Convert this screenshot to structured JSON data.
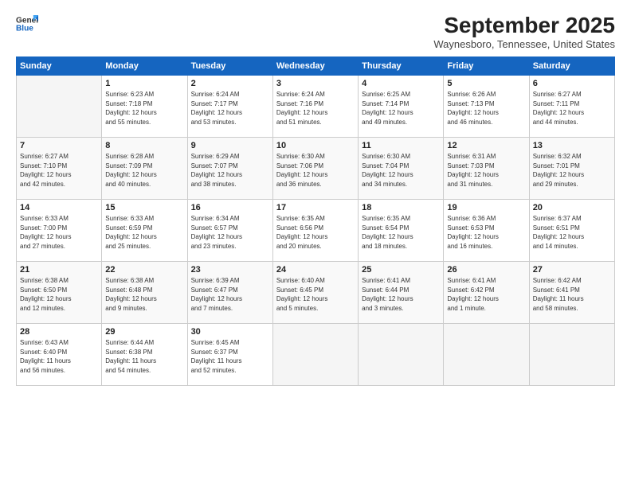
{
  "header": {
    "logo_line1": "General",
    "logo_line2": "Blue",
    "month_title": "September 2025",
    "location": "Waynesboro, Tennessee, United States"
  },
  "weekdays": [
    "Sunday",
    "Monday",
    "Tuesday",
    "Wednesday",
    "Thursday",
    "Friday",
    "Saturday"
  ],
  "weeks": [
    [
      {
        "day": "",
        "info": ""
      },
      {
        "day": "1",
        "info": "Sunrise: 6:23 AM\nSunset: 7:18 PM\nDaylight: 12 hours\nand 55 minutes."
      },
      {
        "day": "2",
        "info": "Sunrise: 6:24 AM\nSunset: 7:17 PM\nDaylight: 12 hours\nand 53 minutes."
      },
      {
        "day": "3",
        "info": "Sunrise: 6:24 AM\nSunset: 7:16 PM\nDaylight: 12 hours\nand 51 minutes."
      },
      {
        "day": "4",
        "info": "Sunrise: 6:25 AM\nSunset: 7:14 PM\nDaylight: 12 hours\nand 49 minutes."
      },
      {
        "day": "5",
        "info": "Sunrise: 6:26 AM\nSunset: 7:13 PM\nDaylight: 12 hours\nand 46 minutes."
      },
      {
        "day": "6",
        "info": "Sunrise: 6:27 AM\nSunset: 7:11 PM\nDaylight: 12 hours\nand 44 minutes."
      }
    ],
    [
      {
        "day": "7",
        "info": "Sunrise: 6:27 AM\nSunset: 7:10 PM\nDaylight: 12 hours\nand 42 minutes."
      },
      {
        "day": "8",
        "info": "Sunrise: 6:28 AM\nSunset: 7:09 PM\nDaylight: 12 hours\nand 40 minutes."
      },
      {
        "day": "9",
        "info": "Sunrise: 6:29 AM\nSunset: 7:07 PM\nDaylight: 12 hours\nand 38 minutes."
      },
      {
        "day": "10",
        "info": "Sunrise: 6:30 AM\nSunset: 7:06 PM\nDaylight: 12 hours\nand 36 minutes."
      },
      {
        "day": "11",
        "info": "Sunrise: 6:30 AM\nSunset: 7:04 PM\nDaylight: 12 hours\nand 34 minutes."
      },
      {
        "day": "12",
        "info": "Sunrise: 6:31 AM\nSunset: 7:03 PM\nDaylight: 12 hours\nand 31 minutes."
      },
      {
        "day": "13",
        "info": "Sunrise: 6:32 AM\nSunset: 7:01 PM\nDaylight: 12 hours\nand 29 minutes."
      }
    ],
    [
      {
        "day": "14",
        "info": "Sunrise: 6:33 AM\nSunset: 7:00 PM\nDaylight: 12 hours\nand 27 minutes."
      },
      {
        "day": "15",
        "info": "Sunrise: 6:33 AM\nSunset: 6:59 PM\nDaylight: 12 hours\nand 25 minutes."
      },
      {
        "day": "16",
        "info": "Sunrise: 6:34 AM\nSunset: 6:57 PM\nDaylight: 12 hours\nand 23 minutes."
      },
      {
        "day": "17",
        "info": "Sunrise: 6:35 AM\nSunset: 6:56 PM\nDaylight: 12 hours\nand 20 minutes."
      },
      {
        "day": "18",
        "info": "Sunrise: 6:35 AM\nSunset: 6:54 PM\nDaylight: 12 hours\nand 18 minutes."
      },
      {
        "day": "19",
        "info": "Sunrise: 6:36 AM\nSunset: 6:53 PM\nDaylight: 12 hours\nand 16 minutes."
      },
      {
        "day": "20",
        "info": "Sunrise: 6:37 AM\nSunset: 6:51 PM\nDaylight: 12 hours\nand 14 minutes."
      }
    ],
    [
      {
        "day": "21",
        "info": "Sunrise: 6:38 AM\nSunset: 6:50 PM\nDaylight: 12 hours\nand 12 minutes."
      },
      {
        "day": "22",
        "info": "Sunrise: 6:38 AM\nSunset: 6:48 PM\nDaylight: 12 hours\nand 9 minutes."
      },
      {
        "day": "23",
        "info": "Sunrise: 6:39 AM\nSunset: 6:47 PM\nDaylight: 12 hours\nand 7 minutes."
      },
      {
        "day": "24",
        "info": "Sunrise: 6:40 AM\nSunset: 6:45 PM\nDaylight: 12 hours\nand 5 minutes."
      },
      {
        "day": "25",
        "info": "Sunrise: 6:41 AM\nSunset: 6:44 PM\nDaylight: 12 hours\nand 3 minutes."
      },
      {
        "day": "26",
        "info": "Sunrise: 6:41 AM\nSunset: 6:42 PM\nDaylight: 12 hours\nand 1 minute."
      },
      {
        "day": "27",
        "info": "Sunrise: 6:42 AM\nSunset: 6:41 PM\nDaylight: 11 hours\nand 58 minutes."
      }
    ],
    [
      {
        "day": "28",
        "info": "Sunrise: 6:43 AM\nSunset: 6:40 PM\nDaylight: 11 hours\nand 56 minutes."
      },
      {
        "day": "29",
        "info": "Sunrise: 6:44 AM\nSunset: 6:38 PM\nDaylight: 11 hours\nand 54 minutes."
      },
      {
        "day": "30",
        "info": "Sunrise: 6:45 AM\nSunset: 6:37 PM\nDaylight: 11 hours\nand 52 minutes."
      },
      {
        "day": "",
        "info": ""
      },
      {
        "day": "",
        "info": ""
      },
      {
        "day": "",
        "info": ""
      },
      {
        "day": "",
        "info": ""
      }
    ]
  ]
}
